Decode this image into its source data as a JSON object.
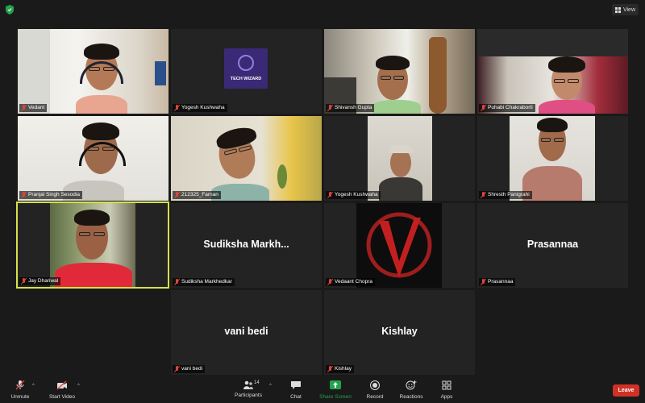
{
  "view_label": "View",
  "participants": [
    {
      "name": "Vedant"
    },
    {
      "name": "Yogesh Kushwaha",
      "logo_text": "TECH WIZARD"
    },
    {
      "name": "Shivansh Gupta"
    },
    {
      "name": "Puhabi Chakraborti"
    },
    {
      "name": "Pranjal Singh Sesodia"
    },
    {
      "name": "212325_Farnan"
    },
    {
      "name": "Yogesh Kushwaha"
    },
    {
      "name": "Shresth Panigrahi"
    },
    {
      "name": "Jay Dhariwal"
    },
    {
      "name": "Sudiksha Markhedkar",
      "display_name": "Sudiksha  Markh..."
    },
    {
      "name": "Vedaant Chopra"
    },
    {
      "name": "Prasannaa",
      "display_name": "Prasannaa"
    },
    {
      "name": "vani bedi",
      "display_name": "vani bedi"
    },
    {
      "name": "Kishlay",
      "display_name": "Kishlay"
    }
  ],
  "toolbar": {
    "unmute": "Unmute",
    "start_video": "Start Video",
    "participants": "Participants",
    "participants_count": "14",
    "chat": "Chat",
    "share_screen": "Share Screen",
    "record": "Record",
    "reactions": "Reactions",
    "apps": "Apps",
    "leave": "Leave"
  },
  "colors": {
    "active_speaker": "#d6e14a",
    "share_green": "#23a24d",
    "leave_red": "#cf3125",
    "mute_red": "#e0453a"
  }
}
